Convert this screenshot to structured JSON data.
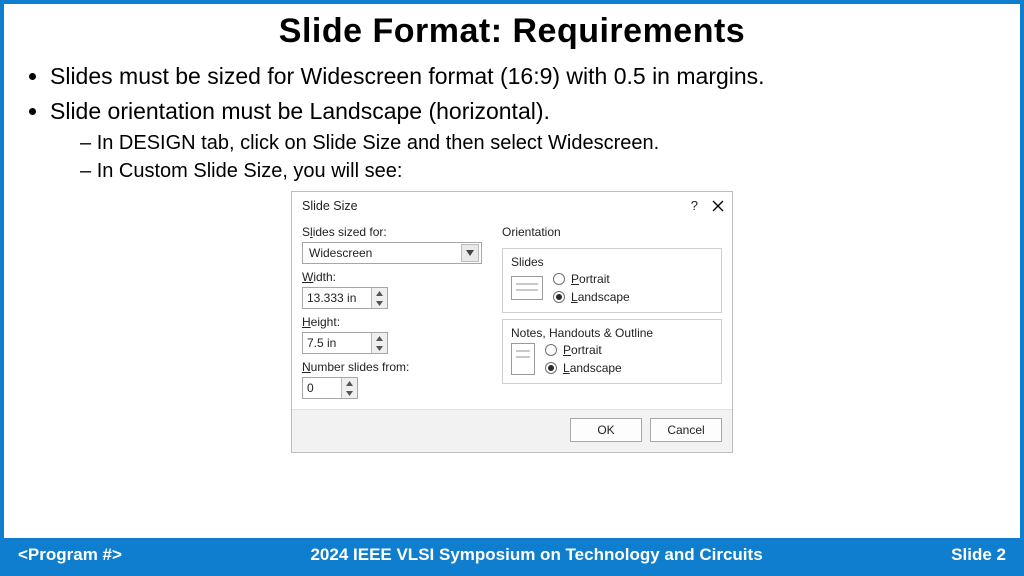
{
  "title": "Slide Format: Requirements",
  "bullets": {
    "b1": "Slides must be sized for Widescreen format (16:9) with 0.5 in margins.",
    "b2": "Slide orientation must be Landscape (horizontal).",
    "s1": "In DESIGN tab, click on Slide Size and then select Widescreen.",
    "s2": "In Custom Slide Size, you will see:"
  },
  "dialog": {
    "title": "Slide Size",
    "help": "?",
    "labels": {
      "sized_for_pre": "S",
      "sized_for_mid": "l",
      "sized_for_rest": "ides sized for:",
      "width_u": "W",
      "width_rest": "idth:",
      "height_u": "H",
      "height_rest": "eight:",
      "number_u": "N",
      "number_rest": "umber slides from:",
      "orientation": "Orientation",
      "slides": "Slides",
      "notes": "Notes, Handouts & Outline",
      "portrait_u": "P",
      "portrait_rest": "ortrait",
      "landscape_u": "L",
      "landscape_rest": "andscape"
    },
    "values": {
      "sized_for": "Widescreen",
      "width": "13.333 in",
      "height": "7.5 in",
      "number_from": "0"
    },
    "buttons": {
      "ok": "OK",
      "cancel": "Cancel"
    }
  },
  "footer": {
    "left": "<Program #>",
    "center": "2024 IEEE VLSI Symposium on Technology and Circuits",
    "right": "Slide 2"
  }
}
